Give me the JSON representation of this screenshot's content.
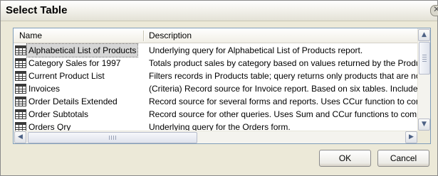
{
  "window": {
    "title": "Select Table"
  },
  "columns": {
    "name": "Name",
    "description": "Description"
  },
  "rows": [
    {
      "name": "Alphabetical List of Products",
      "description": "Underlying query for Alphabetical List of Products report.",
      "selected": true
    },
    {
      "name": "Category Sales for 1997",
      "description": "Totals product sales by category based on values returned by the Product",
      "selected": false
    },
    {
      "name": "Current Product List",
      "description": "Filters records in Products table; query returns only products that are not",
      "selected": false
    },
    {
      "name": "Invoices",
      "description": "(Criteria) Record source for Invoice report. Based on six tables. Includes e",
      "selected": false
    },
    {
      "name": "Order Details Extended",
      "description": "Record source for several forms and reports. Uses CCur function to compu",
      "selected": false
    },
    {
      "name": "Order Subtotals",
      "description": "Record source for other queries. Uses Sum and CCur functions to compute",
      "selected": false
    },
    {
      "name": "Orders Qry",
      "description": "Underlying query for the Orders form.",
      "selected": false
    }
  ],
  "buttons": {
    "ok": "OK",
    "cancel": "Cancel"
  },
  "icons": {
    "row_icon": "query-table-icon",
    "close": "close-icon"
  }
}
